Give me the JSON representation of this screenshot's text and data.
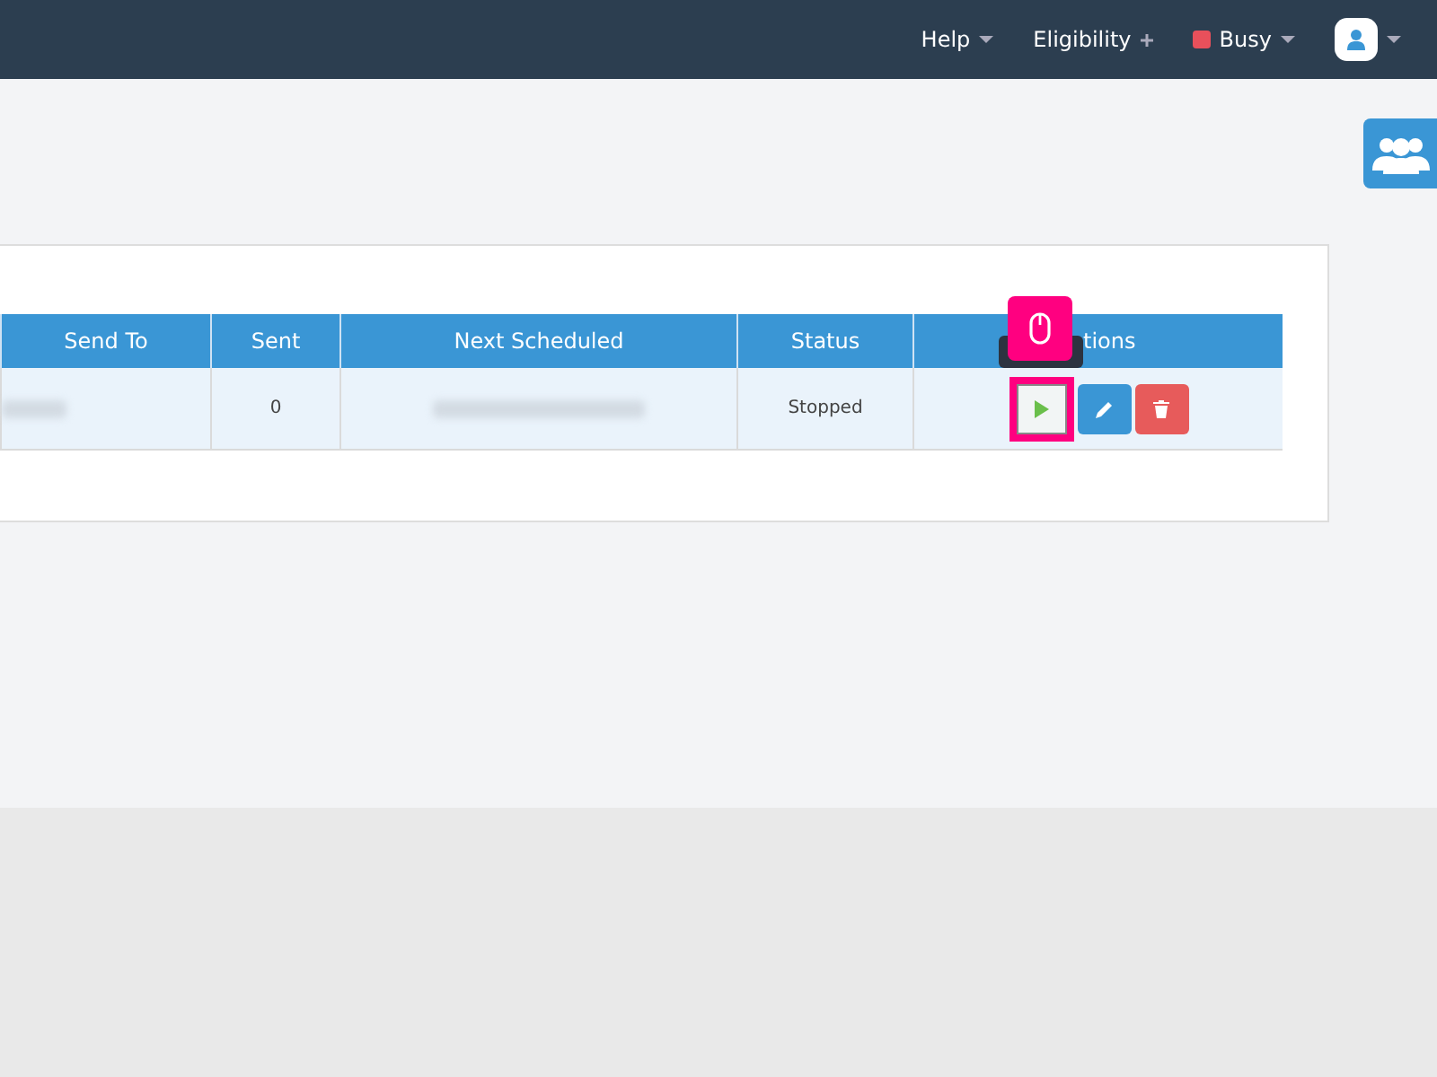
{
  "topbar": {
    "menus": [
      {
        "label": "Help",
        "kind": "caret"
      },
      {
        "label": "Eligibility",
        "kind": "plus"
      }
    ],
    "status": {
      "label": "Busy",
      "color": "#e8505b"
    }
  },
  "table": {
    "columns": [
      "Send To",
      "Sent",
      "Next Scheduled",
      "Status",
      "tions"
    ],
    "rows": [
      {
        "sent": "0",
        "status": "Stopped"
      }
    ]
  }
}
